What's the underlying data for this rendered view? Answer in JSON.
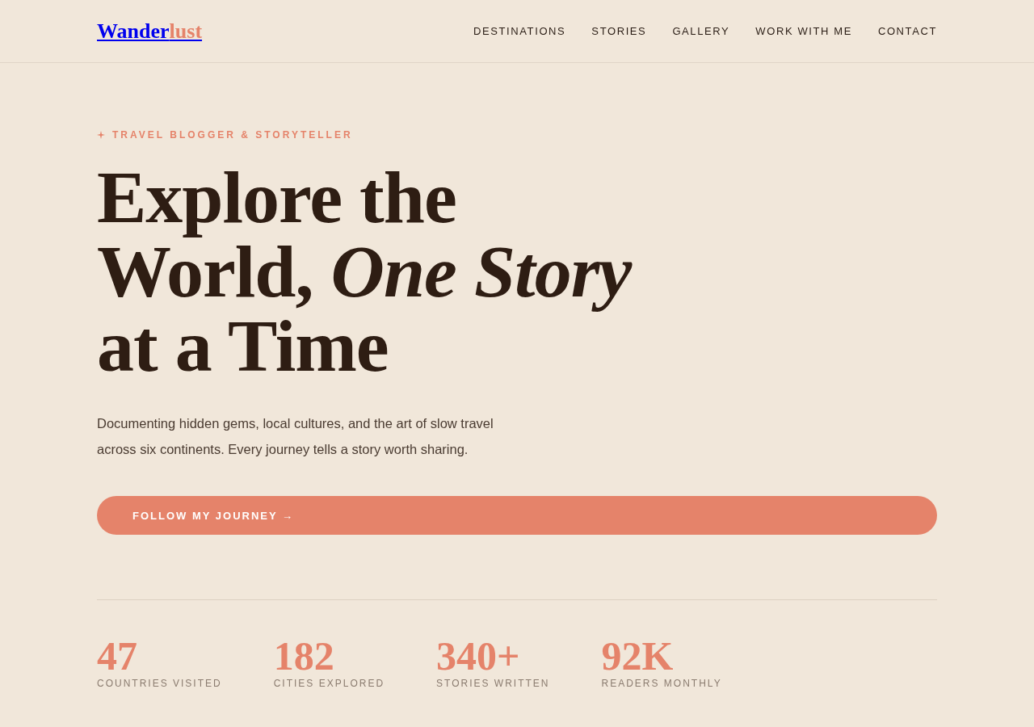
{
  "logo": {
    "first": "Wander",
    "second": "lust"
  },
  "nav": [
    {
      "label": "DESTINATIONS"
    },
    {
      "label": "STORIES"
    },
    {
      "label": "GALLERY"
    },
    {
      "label": "WORK WITH ME"
    },
    {
      "label": "CONTACT"
    }
  ],
  "hero": {
    "eyebrow": "TRAVEL BLOGGER & STORYTELLER",
    "heading": "Explore the World, *One Story* at a Time",
    "description": "Documenting hidden gems, local cultures, and the art of slow travel across six continents. Every journey tells a story worth sharing.",
    "button": "FOLLOW MY JOURNEY →"
  },
  "stats": [
    {
      "value": "47",
      "label": "COUNTRIES VISITED"
    },
    {
      "value": "182",
      "label": "CITIES EXPLORED"
    },
    {
      "value": "340+",
      "label": "STORIES WRITTEN"
    },
    {
      "value": "92K",
      "label": "READERS MONTHLY"
    }
  ]
}
